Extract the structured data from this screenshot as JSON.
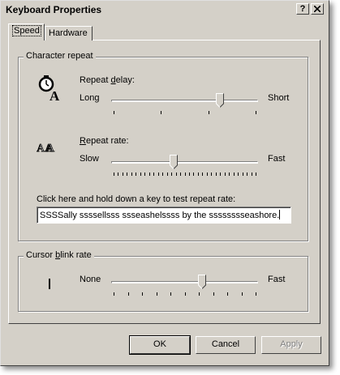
{
  "window": {
    "title": "Keyboard Properties",
    "help_button": "?",
    "close_button": "X"
  },
  "tabs": [
    {
      "label": "Speed",
      "active": true
    },
    {
      "label": "Hardware",
      "active": false
    }
  ],
  "character_repeat": {
    "group_label": "Character repeat",
    "repeat_delay": {
      "label_pre": "Repeat ",
      "label_acc": "d",
      "label_post": "elay:",
      "min_label": "Long",
      "max_label": "Short",
      "value": 0.75,
      "ticks": 4
    },
    "repeat_rate": {
      "label_pre": "",
      "label_acc": "R",
      "label_post": "epeat rate:",
      "min_label": "Slow",
      "max_label": "Fast",
      "value": 0.42,
      "ticks": 33
    },
    "test_label": "Click here and hold down a key to test repeat rate:",
    "test_text": "SSSSally ssssellsss ssseashelssss by the sssssssseashore."
  },
  "cursor_blink": {
    "group_label_pre": "Cursor ",
    "group_label_acc": "b",
    "group_label_post": "link rate",
    "min_label": "None",
    "max_label": "Fast",
    "value": 0.62,
    "ticks": 11
  },
  "buttons": {
    "ok": "OK",
    "cancel": "Cancel",
    "apply": "Apply"
  }
}
